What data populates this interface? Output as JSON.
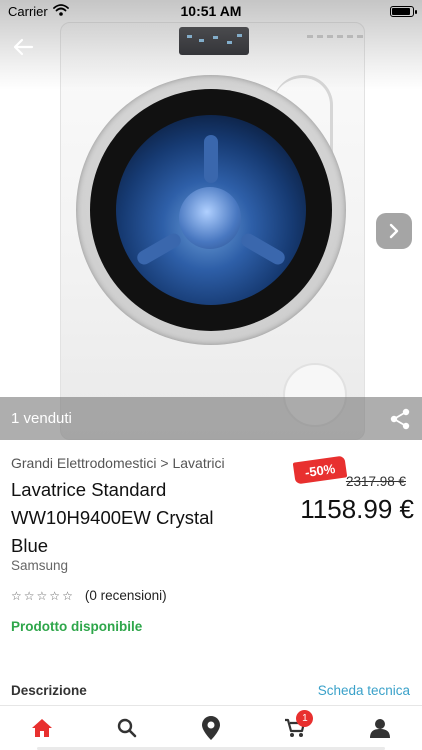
{
  "status_bar": {
    "carrier": "Carrier",
    "time": "10:51 AM",
    "battery_level": 0.95
  },
  "hero": {
    "sold_label": "1 venduti",
    "icons": {
      "back": "back-arrow-icon",
      "next": "chevron-right-icon",
      "share": "share-icon"
    }
  },
  "product": {
    "breadcrumb": "Grandi Elettrodomestici > Lavatrici",
    "title_lines": [
      "Lavatrice Standard",
      "WW10H9400EW Crystal",
      "Blue"
    ],
    "brand": "Samsung",
    "discount": "-50%",
    "old_price": "2317.98 €",
    "price": "1158.99 €",
    "rating": 0,
    "rating_max": 5,
    "reviews_label": "(0 recensioni)",
    "availability": "Prodotto disponibile"
  },
  "details": {
    "description_label": "Descrizione",
    "tech_sheet_link": "Scheda tecnica"
  },
  "tab_bar": {
    "tabs": [
      {
        "icon": "home-icon",
        "active": true
      },
      {
        "icon": "search-icon",
        "active": false
      },
      {
        "icon": "location-pin-icon",
        "active": false
      },
      {
        "icon": "cart-icon",
        "active": false,
        "badge": "1"
      },
      {
        "icon": "user-icon",
        "active": false
      }
    ]
  },
  "colors": {
    "accent_red": "#e8302f",
    "available_green": "#2ea64a",
    "link_blue": "#3aa1c9",
    "tab_icon": "#333333"
  }
}
